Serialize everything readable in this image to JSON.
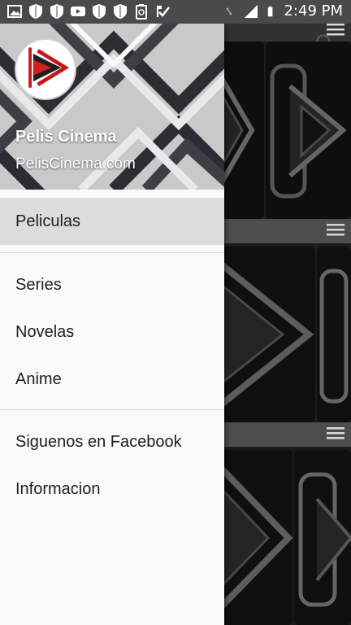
{
  "status_bar": {
    "time": "2:49 PM",
    "icons": [
      "image-icon",
      "shield-icon",
      "shield-icon",
      "youtube-icon",
      "shield-icon",
      "shield-icon",
      "recycle-icon",
      "check-icon"
    ],
    "right_icons": [
      "vibrate-icon",
      "signal-icon",
      "battery-icon"
    ]
  },
  "drawer": {
    "header": {
      "title": "Pelis Cinema",
      "subtitle": "PelisCinema.com"
    },
    "sections": [
      {
        "items": [
          {
            "label": "Peliculas",
            "active": true
          }
        ]
      },
      {
        "items": [
          {
            "label": "Series"
          },
          {
            "label": "Novelas"
          },
          {
            "label": "Anime"
          }
        ]
      },
      {
        "items": [
          {
            "label": "Siguenos en Facebook"
          },
          {
            "label": "Informacion"
          }
        ]
      }
    ]
  },
  "colors": {
    "accent_red": "#d21f1f",
    "active_item_bg": "#dcdcdc",
    "drawer_bg": "#fafafa"
  }
}
